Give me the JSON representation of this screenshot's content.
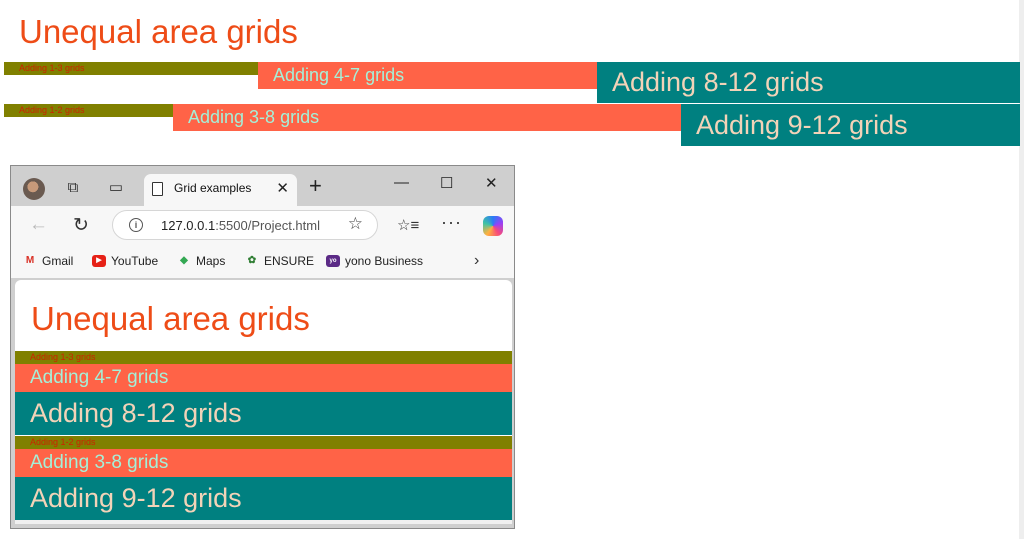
{
  "page": {
    "title": "Unequal area grids",
    "row1": [
      "Adding 1-3 grids",
      "Adding 4-7 grids",
      "Adding 8-12 grids"
    ],
    "row2": [
      "Adding 1-2 grids",
      "Adding 3-8 grids",
      "Adding 9-12 grids"
    ]
  },
  "colors": {
    "title": "#ee4c17",
    "olive": "#808000",
    "tomato": "#ff6347",
    "teal": "#008080"
  },
  "browser": {
    "tab_title": "Grid examples",
    "url_host": "127.0.0.1",
    "url_rest": ":5500/Project.html",
    "bookmarks": [
      {
        "label": "Gmail",
        "icon": "gmail-icon"
      },
      {
        "label": "YouTube",
        "icon": "youtube-icon"
      },
      {
        "label": "Maps",
        "icon": "maps-icon"
      },
      {
        "label": "ENSURE",
        "icon": "ensure-icon"
      },
      {
        "label": "yono Business",
        "icon": "yono-icon"
      }
    ],
    "content": {
      "title": "Unequal area grids",
      "rows": [
        "Adding 1-3 grids",
        "Adding 4-7 grids",
        "Adding 8-12 grids",
        "Adding 1-2 grids",
        "Adding 3-8 grids",
        "Adding 9-12 grids"
      ]
    }
  }
}
